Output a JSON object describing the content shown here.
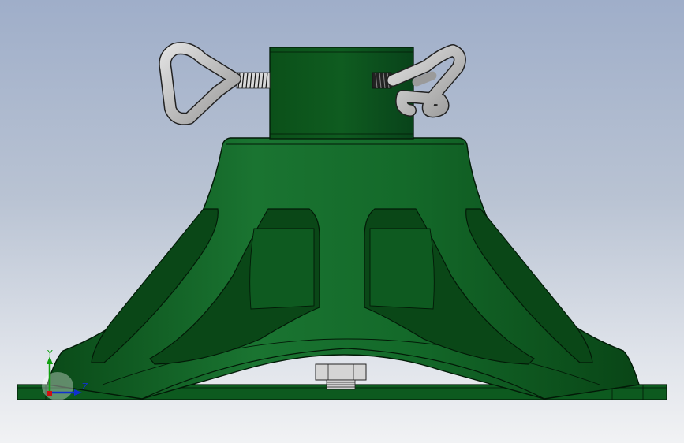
{
  "colors": {
    "background_top": "#9faec9",
    "background_bottom": "#f1f2f4",
    "model_green": "#0d5a1f",
    "model_green_light": "#1c7a33",
    "model_green_dark": "#063a12",
    "edge": "#021a07",
    "screw_gray": "#c3c3c3",
    "axis_x": "#d01010",
    "axis_y": "#10a010",
    "axis_z": "#1030d0"
  },
  "triad": {
    "y_label": "Y",
    "z_label": "Z"
  },
  "icons": {
    "orientation_triad": "axis-triad-icon"
  }
}
